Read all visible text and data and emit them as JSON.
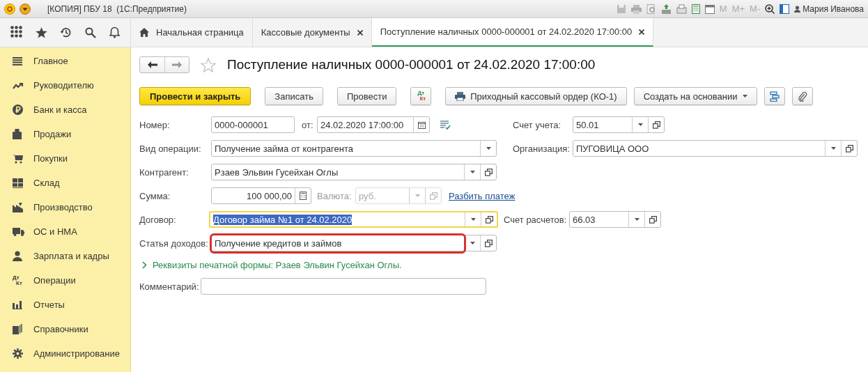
{
  "window": {
    "title": "[КОПИЯ] ПБУ 18  (1С:Предприятие)",
    "memory_buttons": [
      "M",
      "M+",
      "M-"
    ],
    "user": "Мария Иванова"
  },
  "tabs": [
    {
      "label": "Начальная страница",
      "kind": "home",
      "selected": false
    },
    {
      "label": "Кассовые документы",
      "kind": "closable",
      "selected": false
    },
    {
      "label": "Поступление наличных 0000-000001 от 24.02.2020 17:00:00",
      "kind": "closable",
      "selected": true
    }
  ],
  "sidebar": {
    "items": [
      {
        "label": "Главное"
      },
      {
        "label": "Руководителю"
      },
      {
        "label": "Банк и касса"
      },
      {
        "label": "Продажи"
      },
      {
        "label": "Покупки"
      },
      {
        "label": "Склад"
      },
      {
        "label": "Производство"
      },
      {
        "label": "ОС и НМА"
      },
      {
        "label": "Зарплата и кадры"
      },
      {
        "label": "Операции",
        "icon_text": [
          "Дт",
          "Кт"
        ]
      },
      {
        "label": "Отчеты"
      },
      {
        "label": "Справочники"
      },
      {
        "label": "Администрирование"
      }
    ]
  },
  "document": {
    "title": "Поступление наличных 0000-000001 от 24.02.2020 17:00:00"
  },
  "toolbar": [
    {
      "kind": "primary",
      "label": "Провести и закрыть"
    },
    {
      "kind": "text",
      "label": "Записать"
    },
    {
      "kind": "text",
      "label": "Провести"
    },
    {
      "kind": "dtkt",
      "icon_text": [
        "Дт",
        "Кт"
      ]
    },
    {
      "kind": "print",
      "label": "Приходный кассовый ордер (КО-1)"
    },
    {
      "kind": "menu",
      "label": "Создать на основании"
    },
    {
      "kind": "structure"
    },
    {
      "kind": "attach"
    }
  ],
  "form": {
    "number": {
      "label": "Номер:",
      "value": "0000-000001"
    },
    "date": {
      "label": "от:",
      "value": "24.02.2020 17:00:00"
    },
    "account": {
      "label": "Счет учета:",
      "value": "50.01"
    },
    "operation": {
      "label": "Вид операции:",
      "value": "Получение займа от контрагента"
    },
    "organization": {
      "label": "Организация:",
      "value": "ПУГОВИЦА ООО"
    },
    "counterparty": {
      "label": "Контрагент:",
      "value": "Рзаев Эльвин Гусейхан Оглы"
    },
    "amount": {
      "label": "Сумма:",
      "value": "100 000,00"
    },
    "currency": {
      "label": "Валюта:",
      "value": "руб.",
      "disabled": true
    },
    "split_link": "Разбить платеж",
    "contract": {
      "label": "Договор:",
      "value": "Договор займа №1 от 24.02.2020",
      "focused": true
    },
    "settlement_account": {
      "label": "Счет расчетов:",
      "value": "66.03"
    },
    "income_item": {
      "label": "Статья доходов:",
      "value": "Получение кредитов и займов",
      "highlighted": true
    },
    "print_details": {
      "label": "Реквизиты печатной формы: Рзаев Эльвин Гусейхан Оглы.",
      "expanded": false
    },
    "comment": {
      "label": "Комментарий:"
    }
  }
}
